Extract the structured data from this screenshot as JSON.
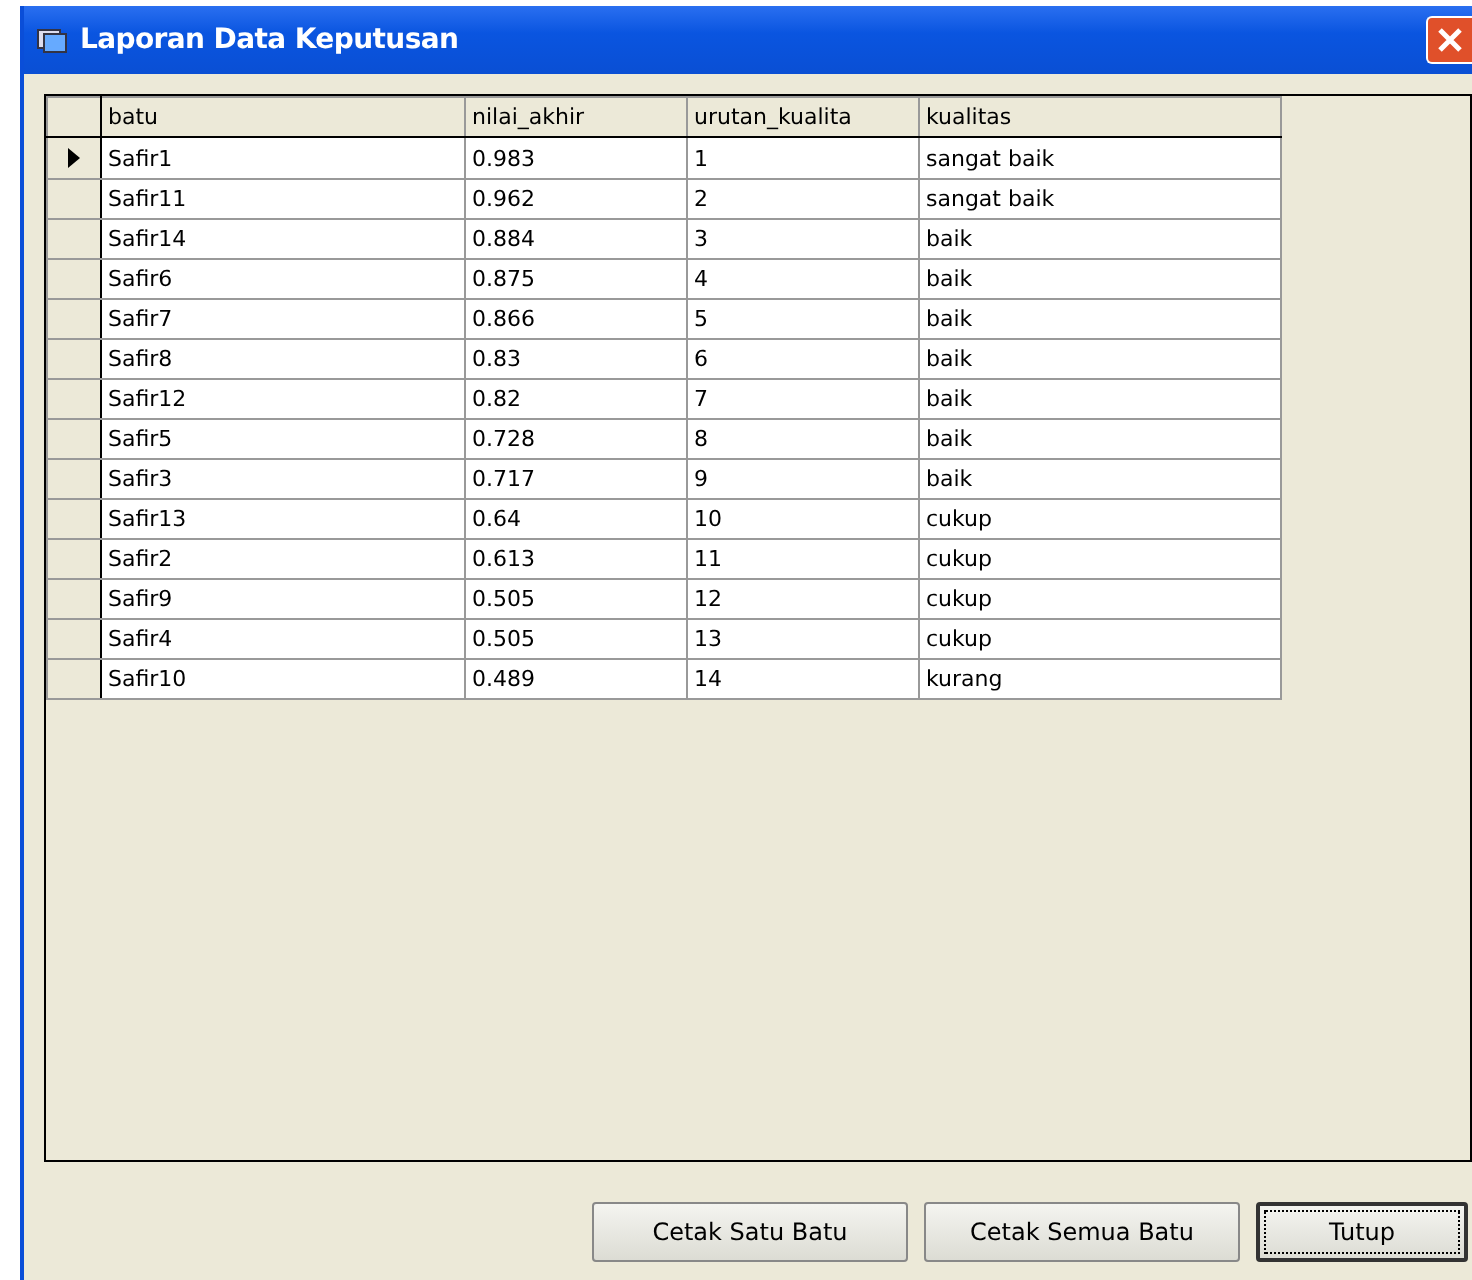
{
  "window": {
    "title": "Laporan Data Keputusan"
  },
  "table": {
    "columns": [
      "batu",
      "nilai_akhir",
      "urutan_kualita",
      "kualitas"
    ],
    "rows": [
      {
        "cells": [
          "Safir1",
          "0.983",
          "1",
          "sangat baik"
        ],
        "selected": true
      },
      {
        "cells": [
          "Safir11",
          "0.962",
          "2",
          "sangat baik"
        ],
        "selected": false
      },
      {
        "cells": [
          "Safir14",
          "0.884",
          "3",
          "baik"
        ],
        "selected": false
      },
      {
        "cells": [
          "Safir6",
          "0.875",
          "4",
          "baik"
        ],
        "selected": false
      },
      {
        "cells": [
          "Safir7",
          "0.866",
          "5",
          "baik"
        ],
        "selected": false
      },
      {
        "cells": [
          "Safir8",
          "0.83",
          "6",
          "baik"
        ],
        "selected": false
      },
      {
        "cells": [
          "Safir12",
          "0.82",
          "7",
          "baik"
        ],
        "selected": false
      },
      {
        "cells": [
          "Safir5",
          "0.728",
          "8",
          "baik"
        ],
        "selected": false
      },
      {
        "cells": [
          "Safir3",
          "0.717",
          "9",
          "baik"
        ],
        "selected": false
      },
      {
        "cells": [
          "Safir13",
          "0.64",
          "10",
          "cukup"
        ],
        "selected": false
      },
      {
        "cells": [
          "Safir2",
          "0.613",
          "11",
          "cukup"
        ],
        "selected": false
      },
      {
        "cells": [
          "Safir9",
          "0.505",
          "12",
          "cukup"
        ],
        "selected": false
      },
      {
        "cells": [
          "Safir4",
          "0.505",
          "13",
          "cukup"
        ],
        "selected": false
      },
      {
        "cells": [
          "Safir10",
          "0.489",
          "14",
          "kurang"
        ],
        "selected": false
      }
    ]
  },
  "buttons": [
    {
      "label": "Cetak Satu Batu",
      "focused": false
    },
    {
      "label": "Cetak Semua Batu",
      "focused": false
    },
    {
      "label": "Tutup",
      "focused": true
    }
  ]
}
